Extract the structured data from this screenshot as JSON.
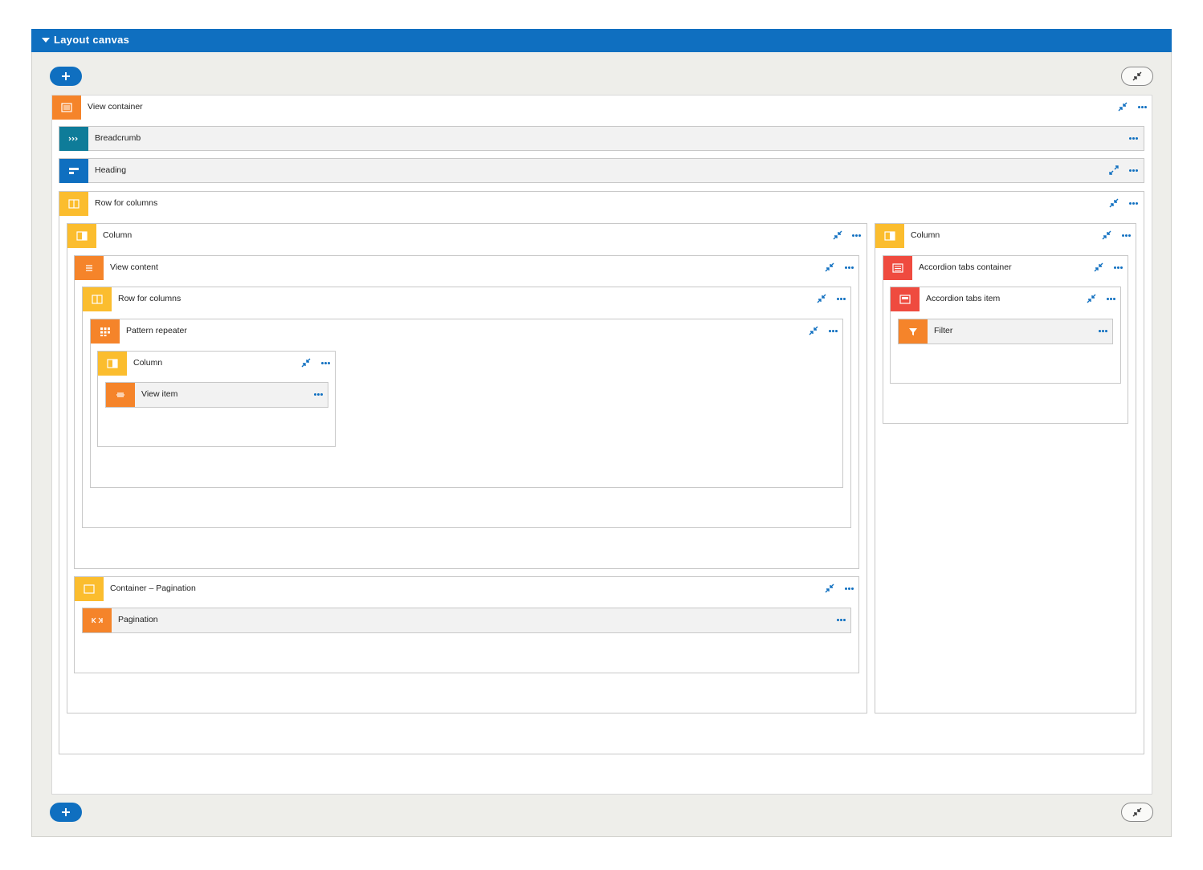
{
  "panel": {
    "title": "Layout canvas"
  },
  "colors": {
    "blue": "#0f6fc0",
    "orange": "#f5842a",
    "yellow": "#fbbd2e",
    "teal": "#0e7c99",
    "red": "#ef4b3f"
  },
  "elements": {
    "view_container": {
      "label": "View container",
      "icon": "list-icon"
    },
    "breadcrumb": {
      "label": "Breadcrumb",
      "icon": "breadcrumb-icon"
    },
    "heading": {
      "label": "Heading",
      "icon": "heading-icon"
    },
    "row_for_columns_outer": {
      "label": "Row for columns",
      "icon": "columns-icon"
    },
    "column_left": {
      "label": "Column",
      "icon": "column-icon"
    },
    "view_content": {
      "label": "View content",
      "icon": "list-icon"
    },
    "row_for_columns_inner": {
      "label": "Row for columns",
      "icon": "columns-icon"
    },
    "pattern_repeater": {
      "label": "Pattern repeater",
      "icon": "grid-icon"
    },
    "column_inner": {
      "label": "Column",
      "icon": "column-icon"
    },
    "view_item": {
      "label": "View item",
      "icon": "item-icon"
    },
    "container_pagination": {
      "label": "Container – Pagination",
      "icon": "container-icon"
    },
    "pagination": {
      "label": "Pagination",
      "icon": "pagination-icon"
    },
    "column_right": {
      "label": "Column",
      "icon": "column-icon"
    },
    "accordion_tabs_container": {
      "label": "Accordion tabs container",
      "icon": "accordion-icon"
    },
    "accordion_tabs_item": {
      "label": "Accordion tabs item",
      "icon": "accordion-icon"
    },
    "filter": {
      "label": "Filter",
      "icon": "filter-icon"
    }
  }
}
